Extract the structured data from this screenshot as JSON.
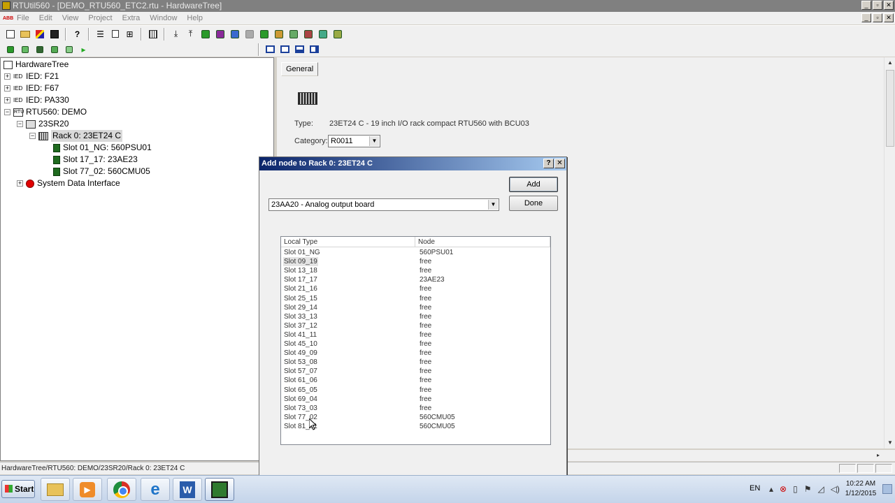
{
  "window": {
    "title": "RTUtil560 - [DEMO_RTU560_ETC2.rtu - HardwareTree]",
    "controls": [
      "_",
      "▫",
      "✕"
    ]
  },
  "menubar": {
    "logo": "ABB",
    "items": [
      "File",
      "Edit",
      "View",
      "Project",
      "Extra",
      "Window",
      "Help"
    ]
  },
  "tree": {
    "root": "HardwareTree",
    "ied1": "IED: F21",
    "ied2": "IED: F67",
    "ied3": "IED: PA330",
    "rtu": "RTU560: DEMO",
    "cpu": "23SR20",
    "rack": "Rack 0: 23ET24 C",
    "slot1": "Slot 01_NG: 560PSU01",
    "slot2": "Slot 17_17: 23AE23",
    "slot3": "Slot 77_02: 560CMU05",
    "sdi": "System Data Interface",
    "ied_icon_text": "IED",
    "rtu_icon_text": "RTU"
  },
  "properties": {
    "tab": "General",
    "type_label": "Type:",
    "type_value": "23ET24 C - 19 inch I/O rack compact RTU560 with BCU03",
    "category_label": "Category:",
    "category_value": "R0011"
  },
  "dialog": {
    "title": "Add node to Rack 0: 23ET24 C",
    "help": "?",
    "close": "✕",
    "add_label": "Add",
    "done_label": "Done",
    "selected_type": "23AA20 - Analog output board",
    "columns": [
      "Local Type",
      "Node"
    ],
    "rows": [
      {
        "slot": "Slot 01_NG",
        "node": "560PSU01"
      },
      {
        "slot": "Slot 09_19",
        "node": "free"
      },
      {
        "slot": "Slot 13_18",
        "node": "free"
      },
      {
        "slot": "Slot 17_17",
        "node": "23AE23"
      },
      {
        "slot": "Slot 21_16",
        "node": "free"
      },
      {
        "slot": "Slot 25_15",
        "node": "free"
      },
      {
        "slot": "Slot 29_14",
        "node": "free"
      },
      {
        "slot": "Slot 33_13",
        "node": "free"
      },
      {
        "slot": "Slot 37_12",
        "node": "free"
      },
      {
        "slot": "Slot 41_11",
        "node": "free"
      },
      {
        "slot": "Slot 45_10",
        "node": "free"
      },
      {
        "slot": "Slot 49_09",
        "node": "free"
      },
      {
        "slot": "Slot 53_08",
        "node": "free"
      },
      {
        "slot": "Slot 57_07",
        "node": "free"
      },
      {
        "slot": "Slot 61_06",
        "node": "free"
      },
      {
        "slot": "Slot 65_05",
        "node": "free"
      },
      {
        "slot": "Slot 69_04",
        "node": "free"
      },
      {
        "slot": "Slot 73_03",
        "node": "free"
      },
      {
        "slot": "Slot 77_02",
        "node": "560CMU05"
      },
      {
        "slot": "Slot 81_01",
        "node": "560CMU05"
      }
    ],
    "highlighted_row": 1
  },
  "statusbar": {
    "path": "HardwareTree/RTU560: DEMO/23SR20/Rack 0: 23ET24 C"
  },
  "taskbar": {
    "start": "Start",
    "language": "EN",
    "time": "10:22 AM",
    "date": "1/12/2015"
  }
}
